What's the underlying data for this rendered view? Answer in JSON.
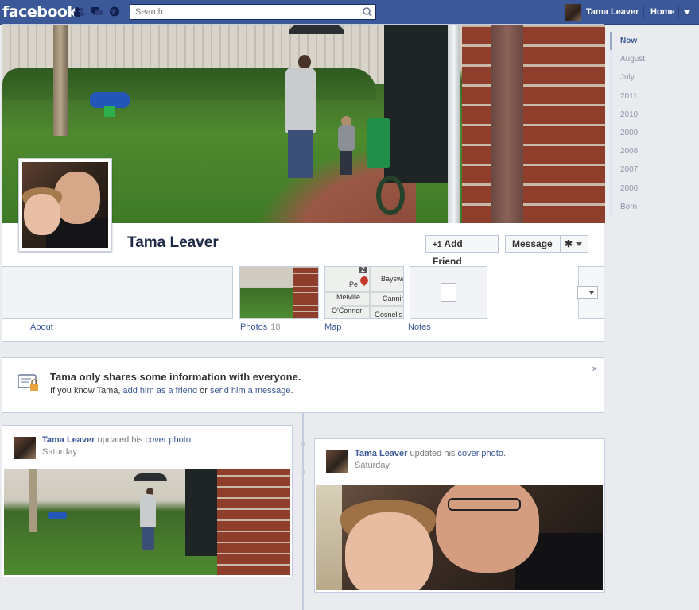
{
  "topbar": {
    "logo": "facebook",
    "search_placeholder": "Search",
    "user_name": "Tama Leaver",
    "home_label": "Home"
  },
  "profile": {
    "name": "Tama Leaver",
    "add_friend_label": "Add Friend",
    "add_friend_prefix": "+1",
    "message_label": "Message",
    "tiles": {
      "about": "About",
      "photos": "Photos",
      "photos_count": "18",
      "map": "Map",
      "notes": "Notes"
    },
    "map_labels": {
      "bayswater": "Bayswater",
      "perth": "Pe",
      "melville": "Melville",
      "canning": "Canning",
      "oconnor": "O'Connor",
      "gosnells": "Gosnells",
      "badge": "2"
    }
  },
  "privacy_notice": {
    "title": "Tama only shares some information with everyone.",
    "prefix": "If you know Tama, ",
    "link1": "add him as a friend",
    "middle": " or ",
    "link2": "send him a message",
    "suffix": ".",
    "close": "×"
  },
  "timeline": {
    "stories": [
      {
        "author": "Tama Leaver",
        "action": " updated his ",
        "object": "cover photo",
        "end": ".",
        "time": "Saturday"
      },
      {
        "author": "Tama Leaver",
        "action": " updated his ",
        "object": "cover photo",
        "end": ".",
        "time": "Saturday"
      }
    ]
  },
  "scrubber": {
    "items": [
      "Now",
      "August",
      "July",
      "2011",
      "2010",
      "2009",
      "2008",
      "2007",
      "2006",
      "Born"
    ]
  },
  "colors": {
    "brand_blue": "#3b5998",
    "link_blue": "#3b5998",
    "page_bg": "#e9ebee"
  }
}
